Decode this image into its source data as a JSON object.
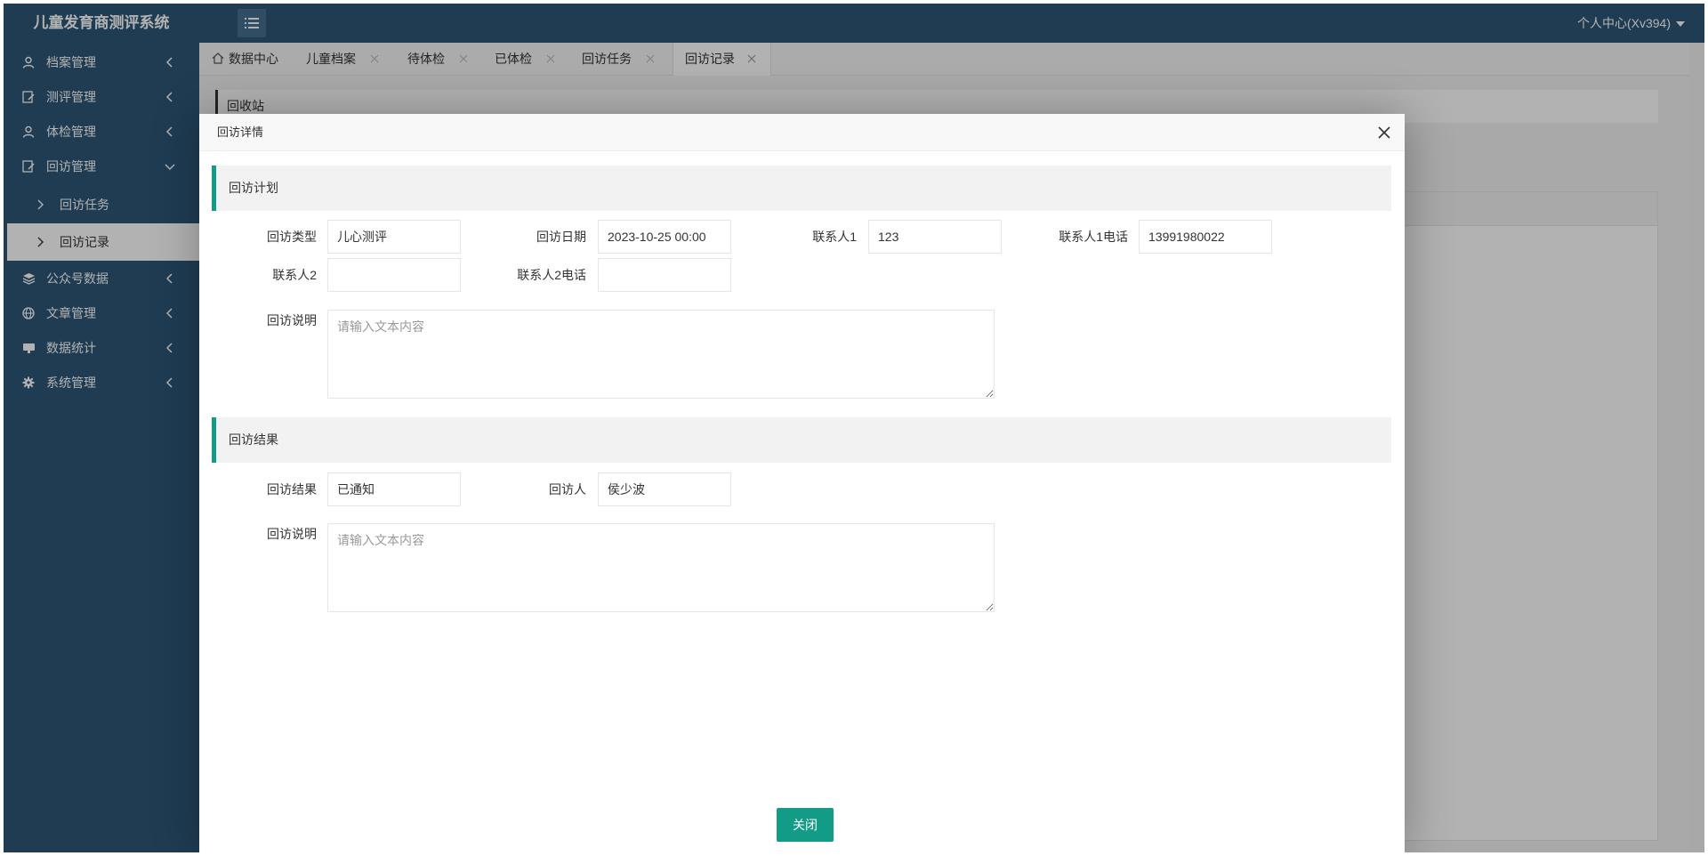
{
  "app": {
    "title": "儿童发育商测评系统",
    "user_center": "个人中心(Xv394)"
  },
  "colors": {
    "primary": "#2d5777",
    "accent": "#129b86"
  },
  "sidebar": {
    "items": [
      {
        "label": "档案管理",
        "icon": "user-icon"
      },
      {
        "label": "测评管理",
        "icon": "edit-doc-icon"
      },
      {
        "label": "体检管理",
        "icon": "user-icon"
      },
      {
        "label": "回访管理",
        "icon": "edit-doc-icon"
      },
      {
        "label": "公众号数据",
        "icon": "layers-icon"
      },
      {
        "label": "文章管理",
        "icon": "globe-icon"
      },
      {
        "label": "数据统计",
        "icon": "monitor-icon"
      },
      {
        "label": "系统管理",
        "icon": "gear-icon"
      }
    ],
    "sub_items": [
      {
        "label": "回访任务"
      },
      {
        "label": "回访记录"
      }
    ]
  },
  "tabs": [
    {
      "label": "数据中心"
    },
    {
      "label": "儿童档案"
    },
    {
      "label": "待体检"
    },
    {
      "label": "已体检"
    },
    {
      "label": "回访任务"
    },
    {
      "label": "回访记录"
    }
  ],
  "background": {
    "panel_label": "回收站"
  },
  "modal": {
    "title": "回访详情",
    "plan_section": "回访计划",
    "result_section": "回访结果",
    "close_button": "关闭",
    "plan": {
      "type_label": "回访类型",
      "type_value": "儿心测评",
      "date_label": "回访日期",
      "date_value": "2023-10-25 00:00",
      "contact1_label": "联系人1",
      "contact1_value": "123",
      "phone1_label": "联系人1电话",
      "phone1_value": "13991980022",
      "contact2_label": "联系人2",
      "contact2_value": "",
      "phone2_label": "联系人2电话",
      "phone2_value": "",
      "desc_label": "回访说明",
      "desc_placeholder": "请输入文本内容"
    },
    "result": {
      "result_label": "回访结果",
      "result_value": "已通知",
      "visitor_label": "回访人",
      "visitor_value": "侯少波",
      "desc_label": "回访说明",
      "desc_placeholder": "请输入文本内容"
    }
  }
}
